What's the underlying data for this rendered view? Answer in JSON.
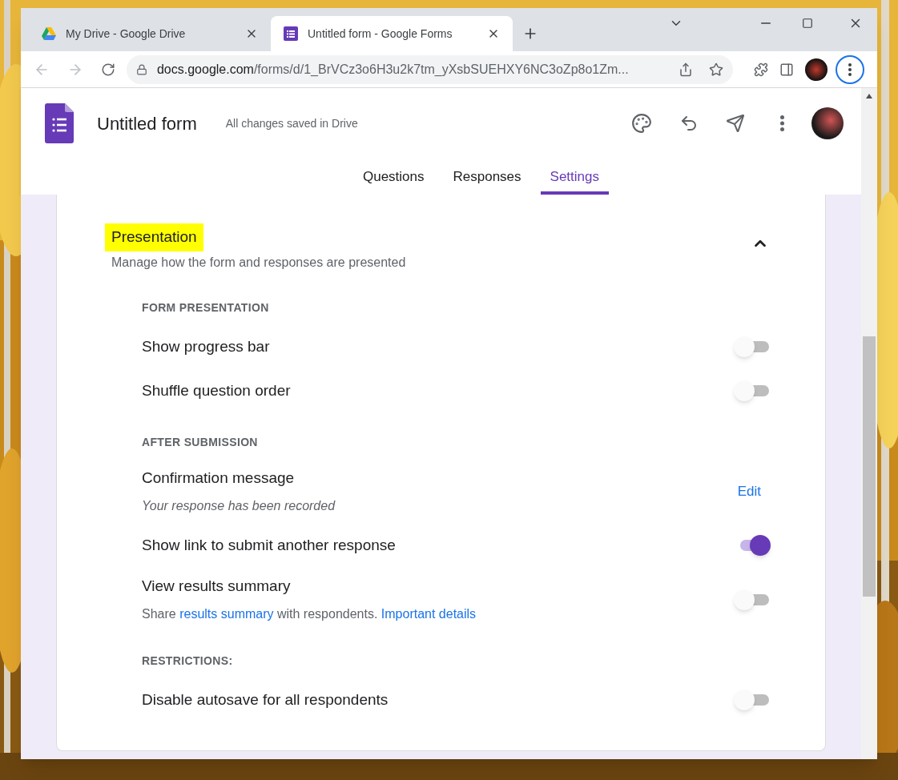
{
  "browser": {
    "tabs": [
      {
        "title": "My Drive - Google Drive",
        "kind": "drive",
        "selected": false
      },
      {
        "title": "Untitled form - Google Forms",
        "kind": "forms",
        "selected": true
      }
    ],
    "address": {
      "host": "docs.google.com",
      "path": "/forms/d/1_BrVCz3o6H3u2k7tm_yXsbSUEHXY6NC3oZp8o1Zm..."
    }
  },
  "form": {
    "title": "Untitled form",
    "save_status": "All changes saved in Drive",
    "tabs": [
      {
        "label": "Questions",
        "selected": false
      },
      {
        "label": "Responses",
        "selected": false
      },
      {
        "label": "Settings",
        "selected": true
      }
    ]
  },
  "section": {
    "title": "Presentation",
    "highlighted": true,
    "subtitle": "Manage how the form and responses are presented",
    "expanded": true,
    "groups": [
      {
        "heading": "FORM PRESENTATION",
        "items": [
          {
            "label": "Show progress bar",
            "kind": "toggle",
            "on": false
          },
          {
            "label": "Shuffle question order",
            "kind": "toggle",
            "on": false
          }
        ]
      },
      {
        "heading": "AFTER SUBMISSION",
        "items": [
          {
            "label": "Confirmation message",
            "kind": "edit",
            "description": [
              {
                "text": "Your response has been recorded",
                "kind": "text"
              }
            ],
            "italic": true,
            "action": "Edit"
          },
          {
            "label": "Show link to submit another response",
            "kind": "toggle",
            "on": true
          },
          {
            "label": "View results summary",
            "kind": "toggle",
            "on": false,
            "description": [
              {
                "text": "Share",
                "kind": "text"
              },
              {
                "text": "results summary",
                "kind": "link"
              },
              {
                "text": "with respondents.",
                "kind": "text"
              },
              {
                "text": "Important details",
                "kind": "link"
              }
            ]
          }
        ]
      },
      {
        "heading": "RESTRICTIONS:",
        "items": [
          {
            "label": "Disable autosave for all respondents",
            "kind": "toggle",
            "on": false
          }
        ]
      }
    ]
  }
}
